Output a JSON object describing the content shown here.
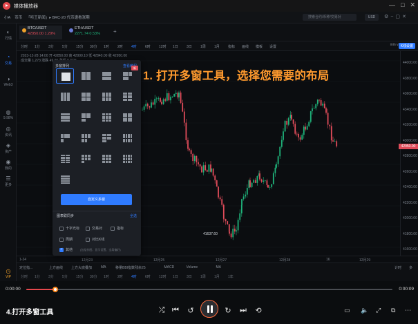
{
  "player": {
    "app_title": "媒体播放器",
    "current_time": "0:00:00",
    "total_time": "0:00:09",
    "progress": 0.08,
    "video_title": "4.打开多窗工具",
    "window_controls": [
      "—",
      "□",
      "✕"
    ]
  },
  "app": {
    "user": "小A",
    "nav_label": "币币",
    "news_ticker": "「听王新闻」▸ BRC-20 代币遭看涨期",
    "search_placeholder": "搜索合约/币种/交易对",
    "currency": "USD"
  },
  "sidebar": {
    "items": [
      {
        "icon": "◐",
        "label": "行情"
      },
      {
        "icon": "◔",
        "label": "交易"
      },
      {
        "icon": "◑",
        "label": "Web3"
      },
      {
        "icon": "◍",
        "label": "9.98%"
      },
      {
        "icon": "◎",
        "label": "资讯"
      },
      {
        "icon": "◈",
        "label": "资产"
      },
      {
        "icon": "◉",
        "label": "我的"
      },
      {
        "icon": "☰",
        "label": "更多"
      },
      {
        "icon": "◷",
        "label": "VIP"
      }
    ]
  },
  "symbols": [
    {
      "name": "BTC/USDT",
      "price": "42950.00  1.29%",
      "up": false
    },
    {
      "name": "ETH/USDT",
      "price": "2271.74  0.53%",
      "up": true
    }
  ],
  "timeframes": [
    "分时",
    "1分",
    "3分",
    "5分",
    "15分",
    "30分",
    "1时",
    "2时",
    "4时",
    "6时",
    "12时",
    "1日",
    "3日",
    "1周",
    "1月",
    "指标",
    "画线",
    "模板",
    "设置"
  ],
  "toolbar_right": "min vals",
  "toolbar_badge": "K线设置",
  "chart": {
    "info_line1": "2023-12-28 14:00  开 42850.00  高 42990.10  低 42840.00  收 42950.00",
    "info_line2": "成交量 1,273  涨跌 49.90  涨幅 0.37%",
    "price_ticks": [
      "44000.00",
      "43800.00",
      "43600.00",
      "43400.00",
      "43200.00",
      "43000.00",
      "42800.00",
      "42600.00",
      "42400.00",
      "42200.00",
      "42000.00",
      "41800.00",
      "41600.00"
    ],
    "last_price": "42950.00",
    "low_label": "41637.60",
    "time_ticks": [
      "1-24",
      "12月23",
      "12月25",
      "12月27",
      "12月28",
      "16",
      "12月29"
    ]
  },
  "annotation": "1. 打开多窗工具，选择您需要的布局",
  "popup": {
    "title": "多窗排列",
    "link": "查看教程",
    "new_badge": "新",
    "custom_button": "自定义多窗",
    "section_title": "图表联同步",
    "section_link": "全选",
    "options": [
      {
        "label": "十字光标",
        "checked": false
      },
      {
        "label": "交易对",
        "checked": false
      },
      {
        "label": "指标",
        "checked": false
      },
      {
        "label": "周期",
        "checked": false
      },
      {
        "label": "对比K线",
        "checked": false
      },
      {
        "label": "其他",
        "checked": true
      }
    ],
    "hint": "(包括作图、显示设置、全局偏好)"
  },
  "indicators_bar": [
    "定位指...",
    "上方画线",
    "上方大底叠加",
    "MA",
    "移量BBI指数残余25",
    "MACD",
    "Volume",
    "MA"
  ],
  "indicator_right": [
    "计时",
    "多"
  ],
  "bottom_timeframes": [
    "分时",
    "1分",
    "3分",
    "5分",
    "15分",
    "30分",
    "1时",
    "2时",
    "4时",
    "6时",
    "12时",
    "1日",
    "3日",
    "1周",
    "1月",
    "1年"
  ],
  "colors": {
    "accent": "#2f7bff",
    "down": "#e04c5a",
    "up": "#1fb37a",
    "annotation": "#ff9a2e"
  }
}
